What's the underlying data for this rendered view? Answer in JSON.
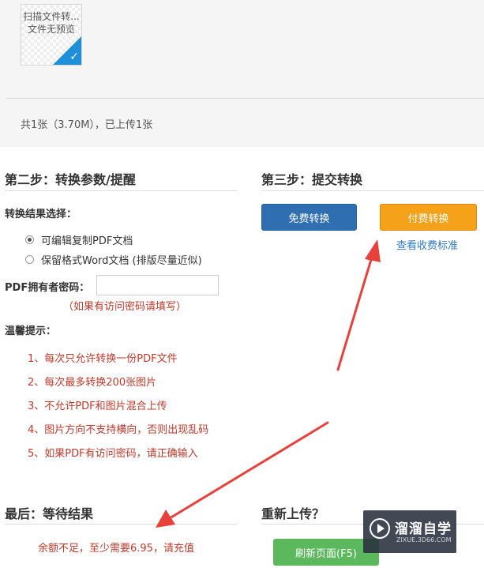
{
  "upload": {
    "thumb_line1": "扫描文件转...",
    "thumb_line2": "文件无预览",
    "count_text": "共1张（3.70M），已上传1张"
  },
  "step2": {
    "title": "第二步：转换参数/提醒",
    "choice_label": "转换结果选择：",
    "options": [
      {
        "label": "可编辑复制PDF文档",
        "selected": true
      },
      {
        "label": "保留格式Word文档 (排版尽量近似)",
        "selected": false
      }
    ],
    "password_label": "PDF拥有者密码：",
    "password_value": "",
    "password_hint": "（如果有访问密码请填写）",
    "tips_title": "温馨提示：",
    "tips": [
      "1、每次只允许转换一份PDF文件",
      "2、每次最多转换200张图片",
      "3、不允许PDF和图片混合上传",
      "4、图片方向不支持横向，否则出现乱码",
      "5、如果PDF有访问密码，请正确输入"
    ]
  },
  "step3": {
    "title": "第三步：提交转换",
    "free_button": "免费转换",
    "paid_button": "付费转换",
    "fee_link": "查看收费标准"
  },
  "final": {
    "title": "最后：等待结果",
    "result_text": "余额不足，至少需要6.95，请充值"
  },
  "reupload": {
    "title": "重新上传？",
    "refresh_button": "刷新页面(F5)"
  },
  "watermark": {
    "title": "溜溜自学",
    "url": "ZIXUE.3D66.COM"
  },
  "colors": {
    "free_button": "#2f6fb1",
    "paid_button": "#f5a21a",
    "refresh_button": "#5cb85c",
    "tip_text": "#c0392b",
    "link": "#2f7abf",
    "arrow": "#e8403a"
  }
}
